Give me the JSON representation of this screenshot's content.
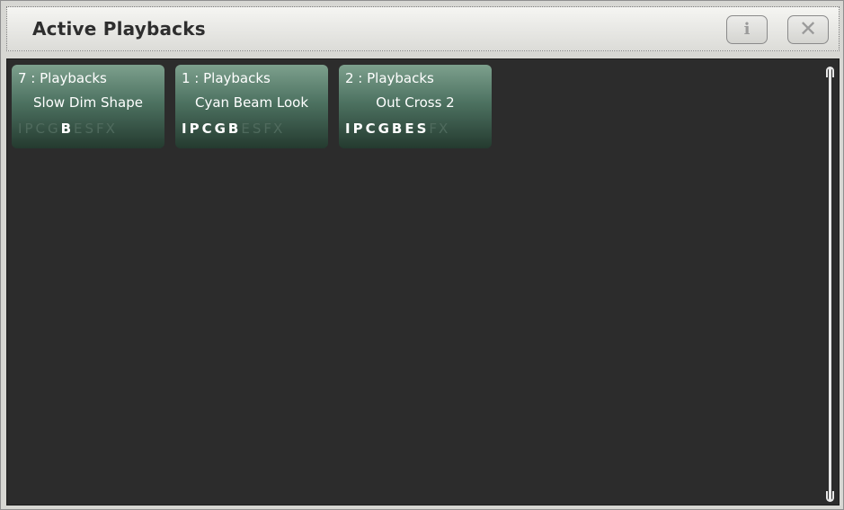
{
  "window": {
    "title": "Active Playbacks"
  },
  "titlebar": {
    "info_label": "i",
    "close_label": "✕"
  },
  "playbacks": [
    {
      "header": "7 : Playbacks",
      "name": "Slow Dim Shape",
      "flags": [
        {
          "label": "I",
          "active": false
        },
        {
          "label": "P",
          "active": false
        },
        {
          "label": "C",
          "active": false
        },
        {
          "label": "G",
          "active": false
        },
        {
          "label": "B",
          "active": true
        },
        {
          "label": "E",
          "active": false
        },
        {
          "label": "S",
          "active": false
        },
        {
          "label": "FX",
          "active": false
        }
      ]
    },
    {
      "header": "1 : Playbacks",
      "name": "Cyan Beam Look",
      "flags": [
        {
          "label": "I",
          "active": true
        },
        {
          "label": "P",
          "active": true
        },
        {
          "label": "C",
          "active": true
        },
        {
          "label": "G",
          "active": true
        },
        {
          "label": "B",
          "active": true
        },
        {
          "label": "E",
          "active": false
        },
        {
          "label": "S",
          "active": false
        },
        {
          "label": "FX",
          "active": false
        }
      ]
    },
    {
      "header": "2 : Playbacks",
      "name": "Out Cross 2",
      "flags": [
        {
          "label": "I",
          "active": true
        },
        {
          "label": "P",
          "active": true
        },
        {
          "label": "C",
          "active": true
        },
        {
          "label": "G",
          "active": true
        },
        {
          "label": "B",
          "active": true
        },
        {
          "label": "E",
          "active": true
        },
        {
          "label": "S",
          "active": true
        },
        {
          "label": "FX",
          "active": false
        }
      ]
    }
  ],
  "colors": {
    "content_bg": "#2c2c2c",
    "tile_top": "#7da08d",
    "tile_bottom": "#243a2f",
    "flag_off": "#4f6a5d"
  }
}
